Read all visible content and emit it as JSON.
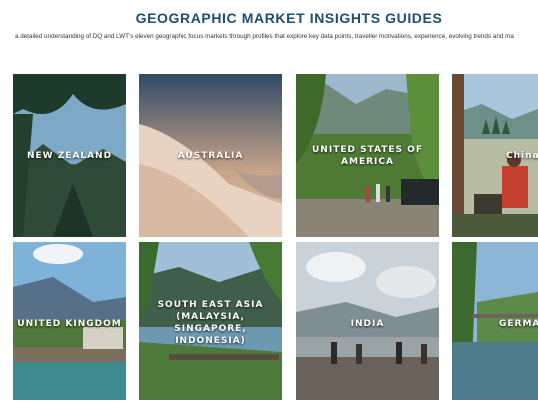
{
  "page": {
    "title": "GEOGRAPHIC MARKET INSIGHTS GUIDES",
    "subtitle": "a detailed understanding of DQ and LWT's eleven geographic focus markets through profiles that explore key data points, traveller motivations, experience, evolving trends and ma"
  },
  "markets": [
    {
      "label": [
        "NEW ZEALAND"
      ]
    },
    {
      "label": [
        "AUSTRALIA"
      ]
    },
    {
      "label": [
        "UNITED STATES OF",
        "AMERICA"
      ]
    },
    {
      "label": [
        "China"
      ]
    },
    {
      "label": [
        "UNITED KINGDOM"
      ]
    },
    {
      "label": [
        "SOUTH EAST ASIA",
        "(MALAYSIA,",
        "SINGAPORE,",
        "INDONESIA)"
      ]
    },
    {
      "label": [
        "INDIA"
      ]
    },
    {
      "label": [
        "GERMAN"
      ]
    }
  ],
  "colors": {
    "title": "#1d4f6e",
    "subtitle": "#333333",
    "label": "#ffffff"
  }
}
